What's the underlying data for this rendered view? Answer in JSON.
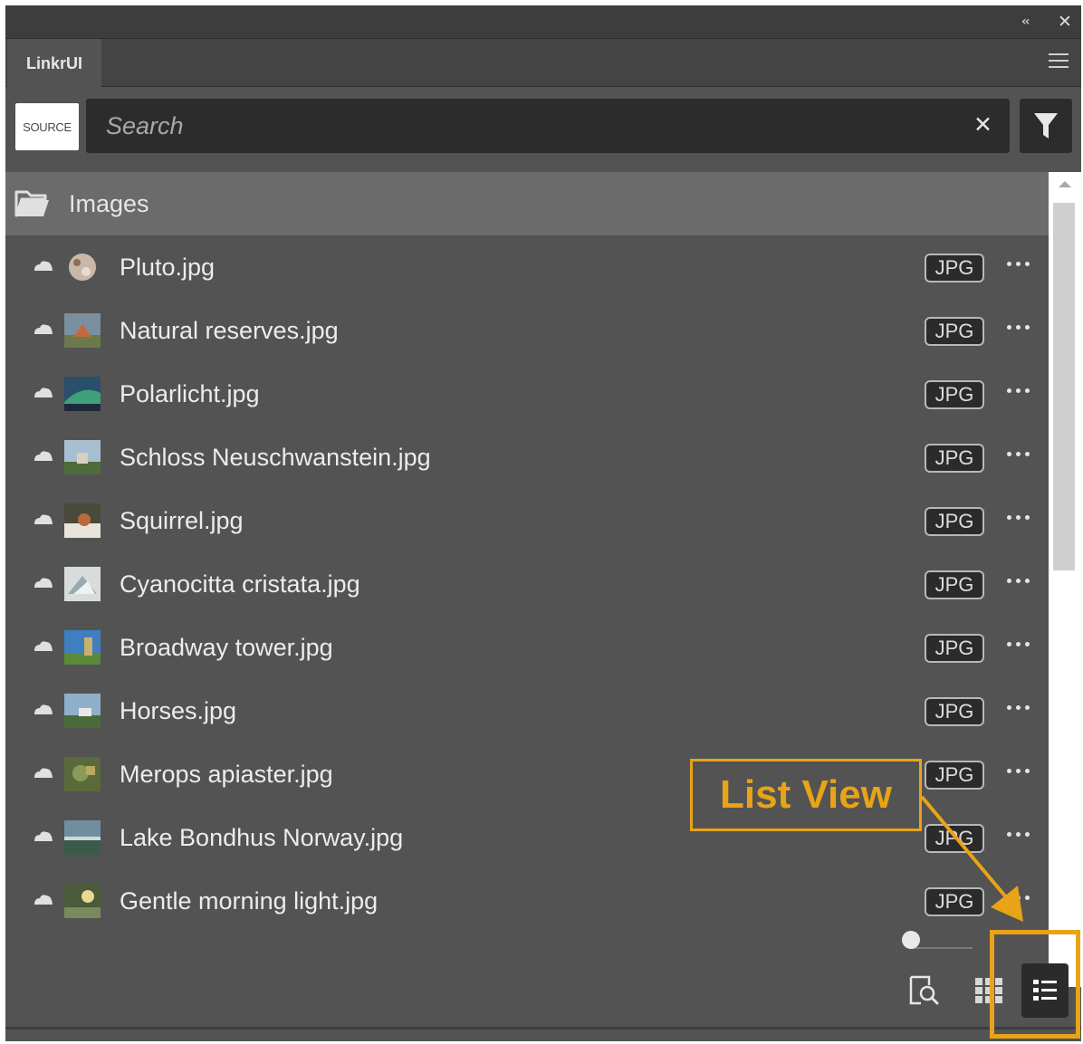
{
  "panel": {
    "title": "LinkrUI"
  },
  "window_controls": {
    "collapse_icon": "double-chevron-left-icon",
    "close_icon": "close-icon",
    "collapse_glyph": "‹‹",
    "close_glyph": "✕"
  },
  "tab_menu_icon": "hamburger-menu-icon",
  "search": {
    "source_label": "SOURCE",
    "placeholder": "Search",
    "value": "",
    "clear_glyph": "✕",
    "filter_icon": "funnel-filter-icon"
  },
  "folder": {
    "name": "Images",
    "icon": "folder-open-icon"
  },
  "files": [
    {
      "name": "Pluto.jpg",
      "type": "JPG"
    },
    {
      "name": "Natural reserves.jpg",
      "type": "JPG"
    },
    {
      "name": "Polarlicht.jpg",
      "type": "JPG"
    },
    {
      "name": "Schloss Neuschwanstein.jpg",
      "type": "JPG"
    },
    {
      "name": "Squirrel.jpg",
      "type": "JPG"
    },
    {
      "name": "Cyanocitta cristata.jpg",
      "type": "JPG"
    },
    {
      "name": "Broadway tower.jpg",
      "type": "JPG"
    },
    {
      "name": "Horses.jpg",
      "type": "JPG"
    },
    {
      "name": "Merops apiaster.jpg",
      "type": "JPG"
    },
    {
      "name": "Lake Bondhus Norway.jpg",
      "type": "JPG"
    },
    {
      "name": "Gentle morning light.jpg",
      "type": "JPG"
    }
  ],
  "footer": {
    "thumbnail_size": 0,
    "preview_icon": "preview-search-icon",
    "grid_view_icon": "grid-view-icon",
    "list_view_icon": "list-view-icon",
    "active_view": "list"
  },
  "annotation": {
    "label": "List View",
    "color": "#e8a317"
  },
  "colors": {
    "panel_bg": "#535353",
    "folder_row_bg": "#6b6b6b",
    "search_bg": "#2c2c2c",
    "accent_annotation": "#e8a317"
  }
}
